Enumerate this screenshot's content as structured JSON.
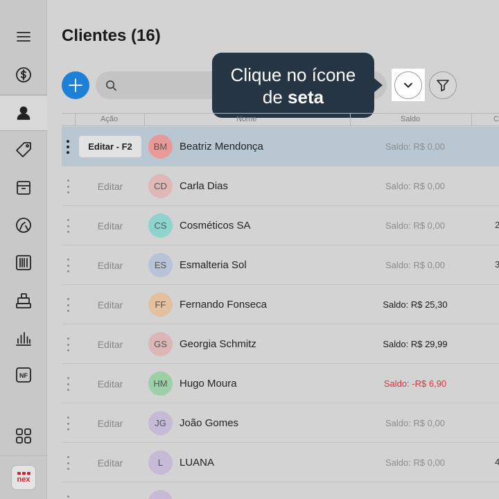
{
  "page": {
    "title": "Clientes (16)"
  },
  "toolbar": {
    "search_placeholder": ""
  },
  "tooltip": {
    "line1": "Clique no ícone",
    "line2_prefix": "de ",
    "line2_bold": "seta"
  },
  "table": {
    "headers": {
      "action": "Ação",
      "name": "Nome",
      "saldo": "Saldo",
      "extra": "C"
    },
    "rows": [
      {
        "initials": "BM",
        "name": "Beatriz Mendonça",
        "action": "Editar - F2",
        "saldo": "Saldo: R$ 0,00",
        "extra": ""
      },
      {
        "initials": "CD",
        "name": "Carla Dias",
        "action": "Editar",
        "saldo": "Saldo: R$ 0,00",
        "extra": ""
      },
      {
        "initials": "CS",
        "name": "Cosméticos SA",
        "action": "Editar",
        "saldo": "Saldo: R$ 0,00",
        "extra": "2"
      },
      {
        "initials": "ES",
        "name": "Esmalteria Sol",
        "action": "Editar",
        "saldo": "Saldo: R$ 0,00",
        "extra": "3"
      },
      {
        "initials": "FF",
        "name": "Fernando Fonseca",
        "action": "Editar",
        "saldo": "Saldo: R$ 25,30",
        "extra": ""
      },
      {
        "initials": "GS",
        "name": "Georgia Schmitz",
        "action": "Editar",
        "saldo": "Saldo: R$ 29,99",
        "extra": ""
      },
      {
        "initials": "HM",
        "name": "Hugo Moura",
        "action": "Editar",
        "saldo": "Saldo: -R$ 6,90",
        "extra": ""
      },
      {
        "initials": "JG",
        "name": "João Gomes",
        "action": "Editar",
        "saldo": "Saldo: R$ 0,00",
        "extra": ""
      },
      {
        "initials": "L",
        "name": "LUANA",
        "action": "Editar",
        "saldo": "Saldo: R$ 0,00",
        "extra": "4"
      }
    ]
  },
  "logo": {
    "text": "nex"
  },
  "colors": {
    "accent": "#1e7fd6",
    "tooltip_bg": "#263544",
    "negative": "#e0303c",
    "selected_row": "#b9c7d3",
    "avatars": [
      "#e89a9a",
      "#e0b7b7",
      "#8fd3cf",
      "#b7c3d6",
      "#e3c1a0",
      "#ddb7b7",
      "#9ed0a8",
      "#c5bbd8",
      "#c5bbd8",
      "#c5bbd8"
    ]
  }
}
